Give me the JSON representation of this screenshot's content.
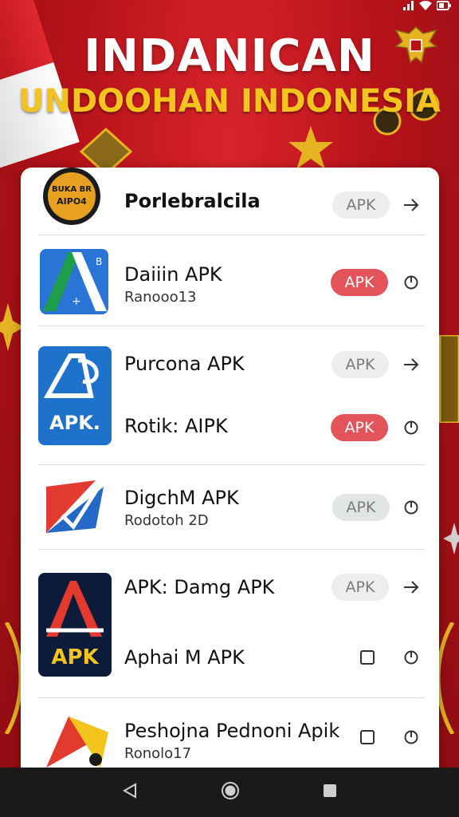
{
  "status_bar": {
    "icons": [
      "signal-icon",
      "wifi-icon",
      "battery-icon"
    ]
  },
  "header": {
    "title": "INDANICAN",
    "subtitle": "UNDOOHAN INDONESIA"
  },
  "apps": [
    {
      "name": "Porlebralcila",
      "sub": "",
      "icon_text": "BUKA BR\nAIPO4",
      "pill": "APK",
      "pill_style": "gray",
      "action": "arrow-right-icon"
    },
    {
      "name": "Daiiin APK",
      "sub": "Ranooo13",
      "pill": "APK",
      "pill_style": "red",
      "action": "power-icon"
    },
    {
      "name": "Purcona APK",
      "sub": "",
      "icon_text": "APK.",
      "pill": "APK",
      "pill_style": "gray",
      "action": "arrow-right-icon"
    },
    {
      "name": "Rotik: AIPK",
      "sub": "",
      "pill": "APK",
      "pill_style": "red",
      "action": "power-icon"
    },
    {
      "name": "DigchM APK",
      "sub": "Rodotoh 2D",
      "pill": "APK",
      "pill_style": "green",
      "action": "power-icon"
    },
    {
      "name": "APK: Damg APK",
      "sub": "",
      "icon_text": "APK",
      "pill": "APK",
      "pill_style": "gray",
      "action": "arrow-right-icon"
    },
    {
      "name": "Aphai M APK",
      "sub": "",
      "action2": "checkbox-icon",
      "action": "power-icon"
    },
    {
      "name": "Peshojna Pednoni Apik",
      "sub": "Ronolo17",
      "action2": "checkbox-icon",
      "action": "power-icon"
    }
  ],
  "colors": {
    "accent_red": "#e2545a",
    "header_yellow": "#f2c41d",
    "background_red": "#b5121b"
  },
  "nav": {
    "icons": [
      "back-icon",
      "home-icon",
      "recents-icon"
    ]
  }
}
